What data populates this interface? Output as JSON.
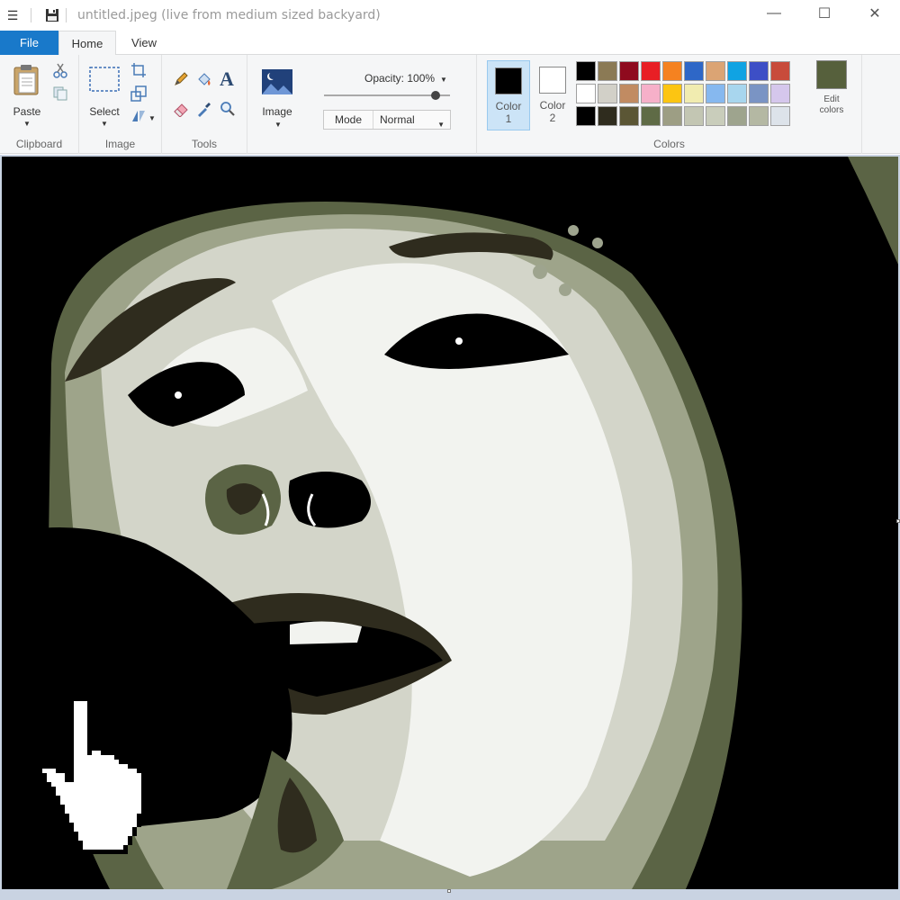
{
  "window": {
    "menu_icon": "hamburger-icon",
    "save_icon": "save-icon",
    "title": "untitled.jpeg (live from medium sized backyard)",
    "minimize": "—",
    "maximize": "☐",
    "close": "✕"
  },
  "tabs": [
    {
      "label": "File"
    },
    {
      "label": "Home"
    },
    {
      "label": "View"
    }
  ],
  "ribbon": {
    "clipboard": {
      "paste_label": "Paste",
      "group_label": "Clipboard",
      "icons": [
        "paste-icon",
        "cut-icon",
        "copy-icon"
      ]
    },
    "image": {
      "select_label": "Select",
      "group_label": "Image",
      "icons": [
        "select-icon",
        "crop-icon",
        "resize-icon",
        "rotate-icon"
      ]
    },
    "tools": {
      "group_label": "Tools",
      "icons": [
        "pencil-icon",
        "fill-icon",
        "text-icon",
        "eraser-icon",
        "color-picker-icon",
        "magnifier-icon"
      ],
      "text_glyph": "A"
    },
    "image_button": {
      "label": "Image"
    },
    "opacity": {
      "label": "Opacity: 100%",
      "value": 100,
      "mode_key": "Mode",
      "mode_value": "Normal"
    },
    "colors": {
      "group_label": "Colors",
      "color1": {
        "label": "Color",
        "number": "1",
        "value": "#000000"
      },
      "color2": {
        "label": "Color",
        "number": "2",
        "value": "#ffffff"
      },
      "edit_label_1": "Edit",
      "edit_label_2": "colors",
      "edit_swatch": "#56603c",
      "palette": [
        "#000000",
        "#8b7a55",
        "#8f0a1e",
        "#e81f25",
        "#f58220",
        "#2e67c7",
        "#dba474",
        "#10a3e3",
        "#3d4fc6",
        "#c84b3b",
        "#ffffff",
        "#d2d0c8",
        "#c18b62",
        "#f6b0c9",
        "#fcc512",
        "#f1ecb0",
        "#86b8ef",
        "#a8d6ee",
        "#7a94c4",
        "#d5c7ec",
        "#000000",
        "#2f2c1e",
        "#5b5635",
        "#5f6b46",
        "#9d9e84",
        "#c3c6b3",
        "#c9cdbb",
        "#9ea48e",
        "#b4b8a3",
        "#dde3ea"
      ]
    }
  }
}
